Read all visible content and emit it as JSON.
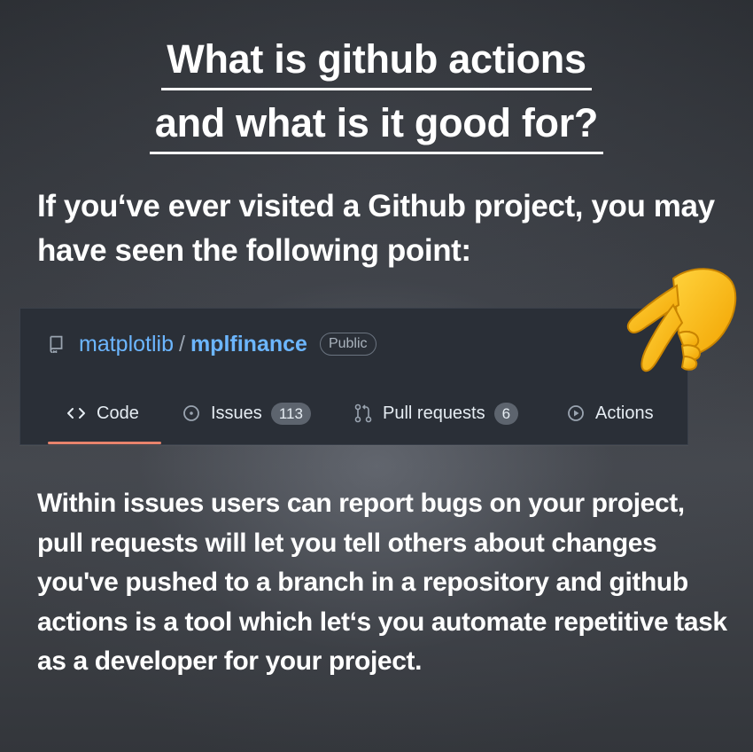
{
  "title": {
    "line1": "What is github actions",
    "line2": "and what is it good for?"
  },
  "intro": "If you‘ve ever visited a Github project, you may have seen the following point:",
  "repo": {
    "owner": "matplotlib",
    "separator": "/",
    "name": "mplfinance",
    "visibility": "Public",
    "icon": "repo-icon"
  },
  "tabs": [
    {
      "label": "Code",
      "icon": "code-icon",
      "selected": true
    },
    {
      "label": "Issues",
      "icon": "issue-icon",
      "count": "113"
    },
    {
      "label": "Pull requests",
      "icon": "pull-request-icon",
      "count": "6"
    },
    {
      "label": "Actions",
      "icon": "play-icon"
    }
  ],
  "pointer": "pointing-hand-icon",
  "body": "Within issues users can report bugs on your project, pull requests will let you tell others about changes you've pushed to a branch in a repository and github actions is a tool which let‘s you automate repetitive task as a developer for your project.",
  "colors": {
    "link": "#6cb6ff",
    "selected_tab_underline": "#e8836c",
    "card_background": "#2a2f37",
    "hand": "#f7b500"
  }
}
